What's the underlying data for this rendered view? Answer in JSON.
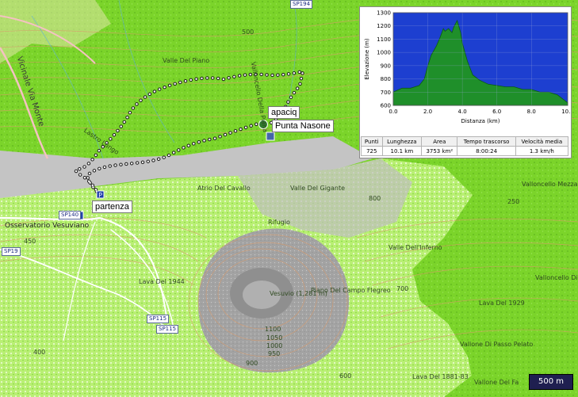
{
  "map": {
    "places": [
      {
        "text": "Valle Del Piano"
      },
      {
        "text": "Lastro Lungo"
      },
      {
        "text": "Atrio Del Cavallo"
      },
      {
        "text": "Valle Del Gigante"
      },
      {
        "text": "Lava Del 1944"
      },
      {
        "text": "Vesuvio (1,281 m)"
      },
      {
        "text": "Valle Dell'Inferno"
      },
      {
        "text": "Piano Del Campo Flegreo"
      },
      {
        "text": "Lava Del 1929"
      },
      {
        "text": "Valloncello Di Piano"
      },
      {
        "text": "Valloncello Mezzano"
      },
      {
        "text": "Lava Del 1881-83"
      },
      {
        "text": "Vallone Del Fa"
      },
      {
        "text": "Osservatorio Vesuviano"
      },
      {
        "text": "Vicinale Via Monte"
      },
      {
        "text": "Valloncello Della Piana"
      },
      {
        "text": "Rifugio"
      },
      {
        "text": "Vallone Di Passo Pelato"
      }
    ],
    "roads": [
      "SP140",
      "SP19",
      "SP115",
      "SP115",
      "SP194"
    ],
    "contours": [
      "1100",
      "1050",
      "1000",
      "950",
      "900",
      "500",
      "450",
      "400",
      "350",
      "300",
      "250",
      "800",
      "700",
      "600"
    ],
    "waypoints": {
      "start": "partenza",
      "summit_name": "apaciq",
      "peak": "Punta Nasone"
    },
    "scale": "500 m",
    "colors": {
      "forest": "#7bd42a",
      "forest_dots": "#5fb51e",
      "clearing": "#b2ef6a",
      "rock": "#9a9a9a",
      "sand": "#c9c9c9",
      "track": "#ffffff",
      "track_outline": "#1a1a1a",
      "profile_fill": "#1f8f2a",
      "profile_sky": "#1d3fd0"
    }
  },
  "profile": {
    "ylabel": "Elevazione (m)",
    "xlabel": "Distanza   (km)",
    "yticks": [
      "1300",
      "1200",
      "1100",
      "1000",
      "900",
      "800",
      "700",
      "600"
    ],
    "xticks": [
      "0.0",
      "2.0",
      "4.0",
      "6.0",
      "8.0",
      "10.1"
    ]
  },
  "stats": {
    "headers": [
      "Punti",
      "Lunghezza",
      "Area",
      "Tempo trascorso",
      "Velocità media"
    ],
    "values": [
      "725",
      "10.1 km",
      "3753 km²",
      "8:00:24",
      "1.3 km/h"
    ]
  },
  "chart_data": {
    "type": "area",
    "xlabel": "Distanza   (km)",
    "ylabel": "Elevazione (m)",
    "xlim": [
      0,
      10.1
    ],
    "ylim": [
      600,
      1300
    ],
    "x": [
      0.0,
      0.5,
      1.0,
      1.5,
      1.8,
      2.0,
      2.2,
      2.5,
      2.7,
      2.9,
      3.0,
      3.2,
      3.4,
      3.5,
      3.7,
      3.9,
      4.0,
      4.3,
      4.6,
      5.0,
      5.5,
      6.0,
      6.5,
      7.0,
      7.5,
      8.0,
      8.5,
      9.0,
      9.5,
      10.1
    ],
    "y": [
      700,
      730,
      730,
      750,
      800,
      900,
      980,
      1050,
      1110,
      1180,
      1160,
      1180,
      1150,
      1190,
      1240,
      1150,
      1070,
      930,
      830,
      790,
      760,
      750,
      740,
      740,
      720,
      720,
      700,
      700,
      680,
      620
    ],
    "grid": true
  }
}
